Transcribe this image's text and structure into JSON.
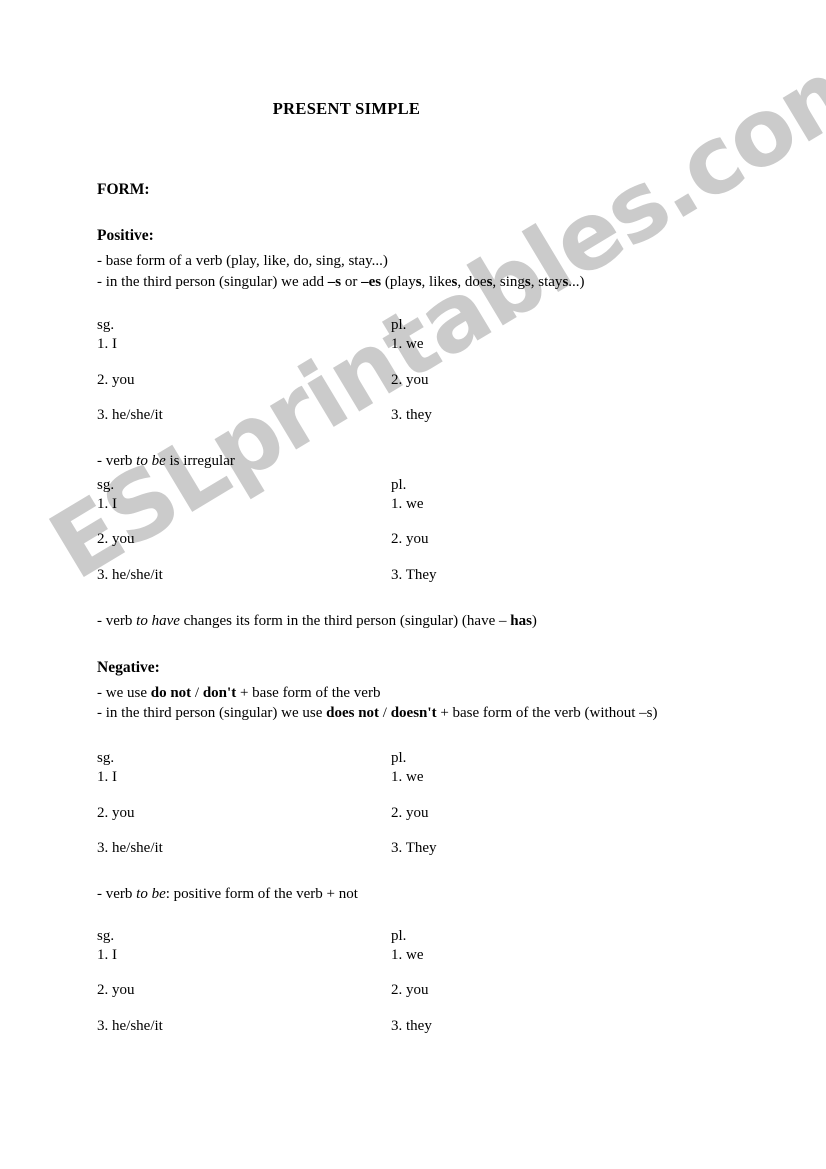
{
  "document": {
    "title": "PRESENT SIMPLE",
    "form_label": "FORM:",
    "watermark": "ESLprintables.com",
    "watermark_color": "#cbcbcb"
  },
  "positive": {
    "label": "Positive:",
    "rules": [
      "- base form of a verb (play, like, do, sing, stay...)",
      "- in the third person (singular) we add –s or –es (plays, likes, does, sings, stays...)"
    ],
    "rule2_parts": {
      "lead": "- in the third person (singular) we add ",
      "bold_s": "–s",
      "mid": " or ",
      "bold_es": "–es",
      "tail_open": " (play",
      "ex1_s": "s",
      "ex2_lead": ", like",
      "ex2_s": "s",
      "ex3_lead": ", doe",
      "ex3_s": "s",
      "ex4_lead": ", sing",
      "ex4_s": "s",
      "ex5_lead": ", stay",
      "ex5_s": "s",
      "tail_close": "...)"
    },
    "table_base": {
      "sg_header": "sg.",
      "pl_header": "pl.",
      "sg": [
        "1. I",
        "2. you",
        "3. he/she/it"
      ],
      "pl": [
        "1. we",
        "2. you",
        "3. they"
      ]
    },
    "note_to_be": {
      "lead": "- verb ",
      "italic": "to be",
      "tail": " is irregular"
    },
    "table_to_be": {
      "sg_header": "sg.",
      "pl_header": "pl.",
      "sg": [
        "1. I",
        "2. you",
        "3. he/she/it"
      ],
      "pl": [
        "1. we",
        "2. you",
        "3. They"
      ]
    },
    "note_to_have": {
      "lead": "- verb ",
      "italic": "to have",
      "mid": " changes its form in the third person (singular) (have – ",
      "bold": "has",
      "tail": ")"
    }
  },
  "negative": {
    "label": "Negative:",
    "rule1": {
      "lead": "- we use ",
      "bold1": "do not",
      "mid": " / ",
      "bold2": "don't",
      "tail": " + base form of the verb"
    },
    "rule2": {
      "lead": "- in the third person (singular) we use ",
      "bold1": "does not",
      "mid": " / ",
      "bold2": "doesn't",
      "tail": " + base form of the verb (without –s)"
    },
    "table_do": {
      "sg_header": "sg.",
      "pl_header": "pl.",
      "sg": [
        "1. I",
        "2. you",
        "3. he/she/it"
      ],
      "pl": [
        "1. we",
        "2. you",
        "3. They"
      ]
    },
    "note_to_be": {
      "lead": "- verb ",
      "italic": "to be",
      "tail": ": positive form of the verb + not"
    },
    "table_to_be": {
      "sg_header": "sg.",
      "pl_header": "pl.",
      "sg": [
        "1. I",
        "2. you",
        "3. he/she/it"
      ],
      "pl": [
        "1. we",
        "2. you",
        "3. they"
      ]
    }
  }
}
